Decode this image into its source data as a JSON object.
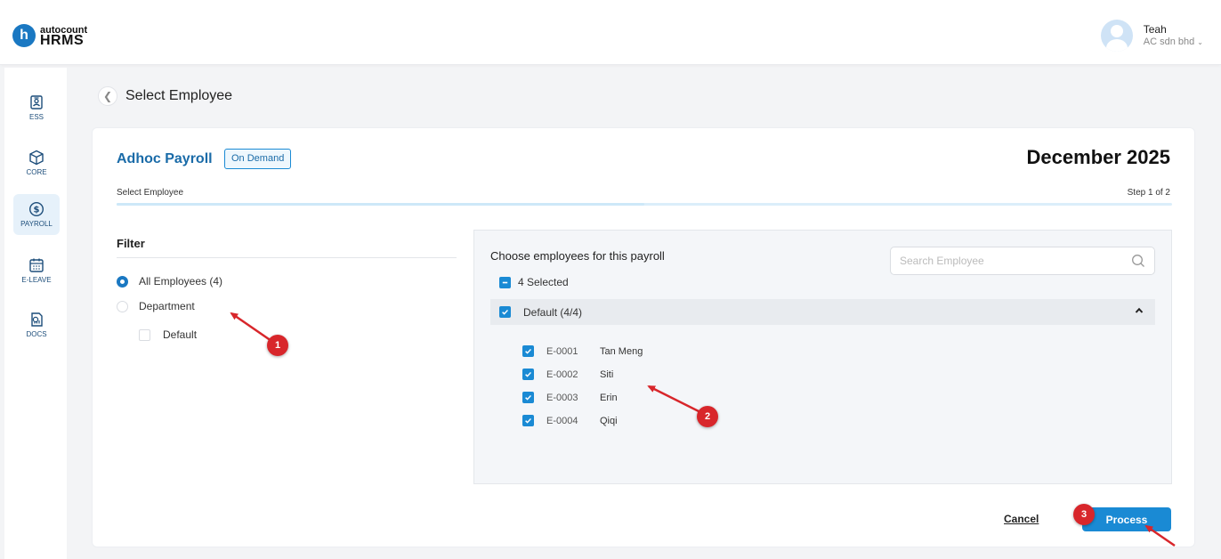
{
  "app": {
    "logo_small": "autocount",
    "logo_big": "HRMS",
    "logo_letter": "h"
  },
  "user": {
    "name": "Teah",
    "company": "AC sdn bhd"
  },
  "sidebar": {
    "items": [
      {
        "label": "ESS",
        "icon": "badge-icon",
        "active": false
      },
      {
        "label": "CORE",
        "icon": "cube-icon",
        "active": false
      },
      {
        "label": "PAYROLL",
        "icon": "dollar-icon",
        "active": true
      },
      {
        "label": "E-LEAVE",
        "icon": "calendar-icon",
        "active": false
      },
      {
        "label": "DOCS",
        "icon": "report-icon",
        "active": false
      }
    ]
  },
  "header": {
    "title": "Select Employee"
  },
  "payroll": {
    "title": "Adhoc Payroll",
    "badge": "On Demand",
    "period": "December 2025",
    "step_label": "Select Employee",
    "step_counter": "Step 1 of 2"
  },
  "filter": {
    "title": "Filter",
    "options": [
      {
        "label": "All Employees (4)",
        "selected": true
      },
      {
        "label": "Department",
        "selected": false
      }
    ],
    "departments": [
      {
        "label": "Default",
        "checked": false
      }
    ]
  },
  "employees": {
    "title": "Choose employees for this payroll",
    "search_placeholder": "Search Employee",
    "selected_label": "4 Selected",
    "group": {
      "label": "Default (4/4)",
      "expanded": true
    },
    "list": [
      {
        "code": "E-0001",
        "name": "Tan Meng",
        "checked": true
      },
      {
        "code": "E-0002",
        "name": "Siti",
        "checked": true
      },
      {
        "code": "E-0003",
        "name": "Erin",
        "checked": true
      },
      {
        "code": "E-0004",
        "name": "Qiqi",
        "checked": true
      }
    ]
  },
  "actions": {
    "cancel": "Cancel",
    "process": "Process"
  },
  "annotations": {
    "badge1": "1",
    "badge2": "2",
    "badge3": "3",
    "color": "#d8262b"
  },
  "colors": {
    "accent": "#1a8ad4",
    "title_blue": "#1a6ba8"
  }
}
